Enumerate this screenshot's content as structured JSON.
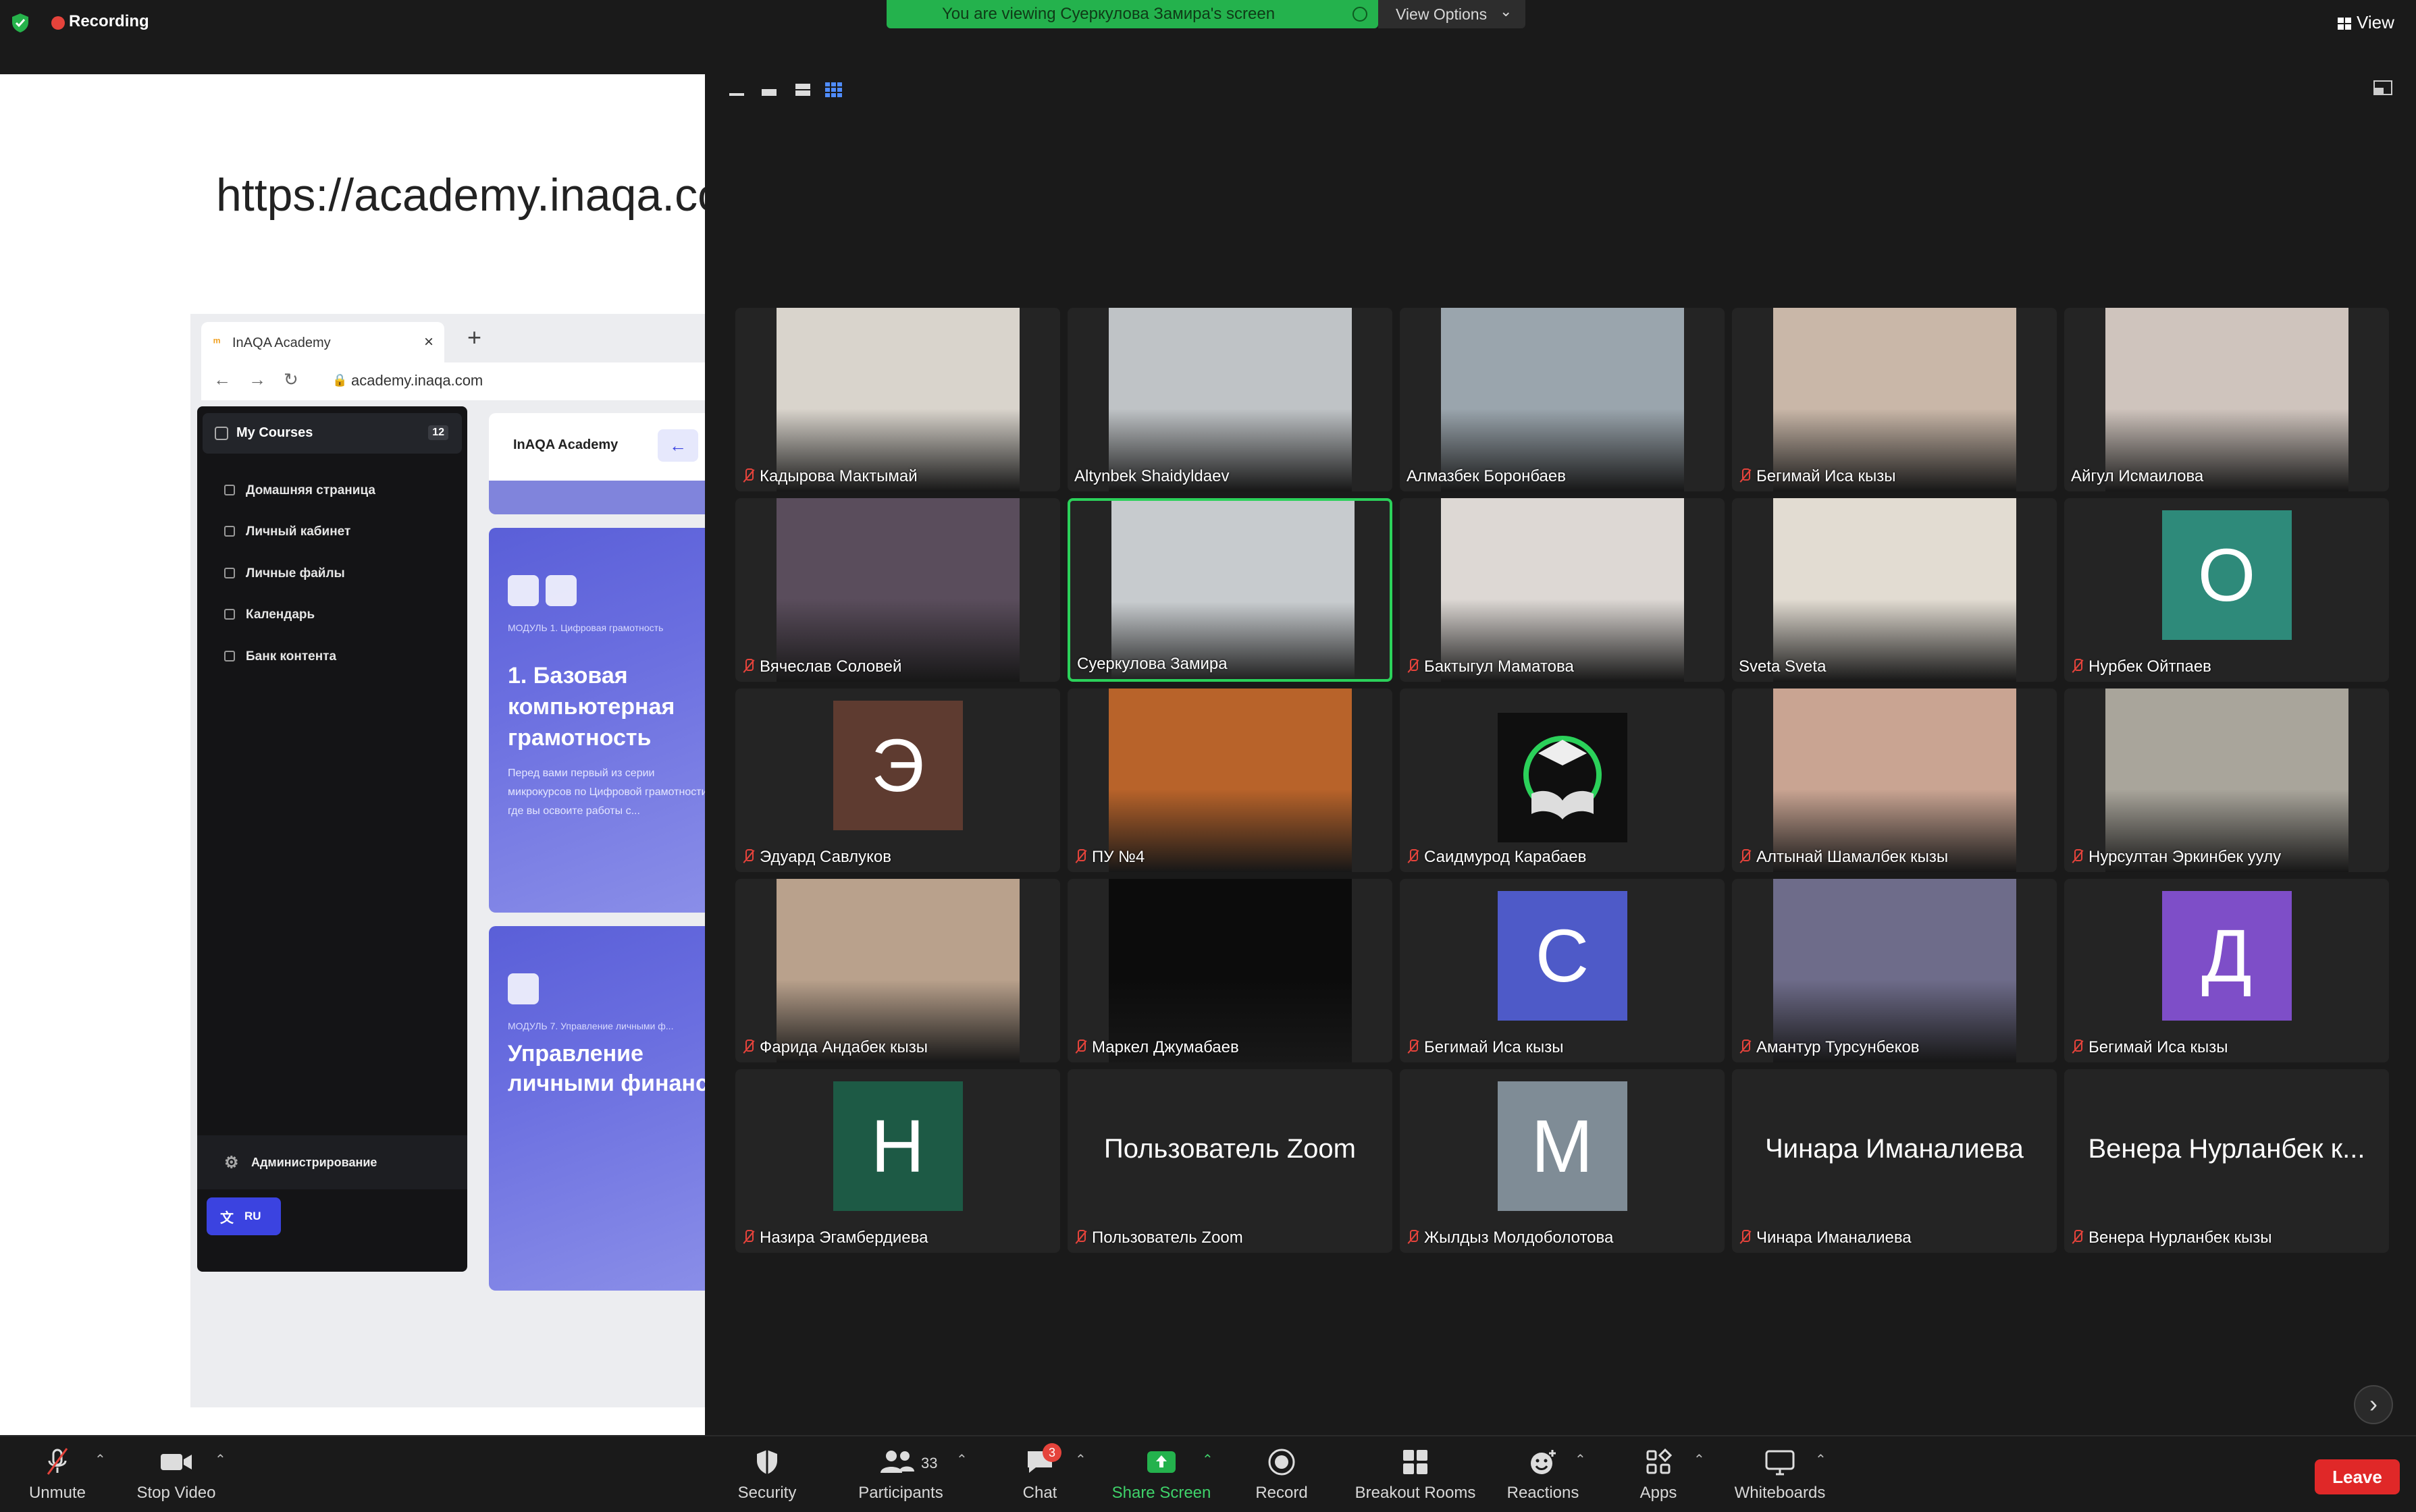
{
  "topbar": {
    "recording_label": "Recording",
    "viewing_banner": "You are viewing Суеркулова Замира's screen",
    "view_options_label": "View Options",
    "view_label": "View"
  },
  "shared_screen": {
    "url_text": "https://academy.inaqa.com",
    "browser_tab_title": "InAQA Academy",
    "browser_address": "academy.inaqa.com",
    "sidebar": {
      "my_courses": "My Courses",
      "my_courses_count": "12",
      "items": [
        "Домашняя страница",
        "Личный кабинет",
        "Личные файлы",
        "Календарь",
        "Банк контента"
      ],
      "admin": "Администрирование",
      "lang": "RU"
    },
    "logo_text": "InAQA Academy",
    "course1": {
      "module": "МОДУЛЬ 1. Цифровая грамотность",
      "title_lines": [
        "1. Базовая",
        "компьютерная",
        "грамотность"
      ],
      "desc": "Перед вами первый из серии микрокурсов по Цифровой грамотности, где вы освоите работы с..."
    },
    "course2": {
      "module": "МОДУЛЬ 7. Управление личными ф...",
      "title_lines": [
        "Управление",
        "личными финанс"
      ]
    }
  },
  "participants": [
    {
      "name": "Кадырова Мактымай",
      "muted": true,
      "kind": "video",
      "color": "#d9d4cc"
    },
    {
      "name": "Altynbek Shaidyldaev",
      "muted": false,
      "kind": "video",
      "color": "#bfc3c6"
    },
    {
      "name": "Алмазбек Боронбаев",
      "muted": false,
      "kind": "video",
      "color": "#9aa5ad"
    },
    {
      "name": "Бегимай Иса кызы",
      "muted": true,
      "kind": "video",
      "color": "#c9b7a8"
    },
    {
      "name": "Айгул Исмаилова",
      "muted": false,
      "kind": "video",
      "color": "#cfc4bd"
    },
    {
      "name": "Вячеслав Соловей",
      "muted": true,
      "kind": "video",
      "color": "#5a4d5c"
    },
    {
      "name": "Суеркулова Замира",
      "muted": false,
      "kind": "video",
      "color": "#c7cbce",
      "active": true
    },
    {
      "name": "Бактыгул Маматова",
      "muted": true,
      "kind": "video",
      "color": "#ddd8d4"
    },
    {
      "name": "Sveta Sveta",
      "muted": false,
      "kind": "video",
      "color": "#e2dcd2"
    },
    {
      "name": "Нурбек Ойтпаев",
      "muted": true,
      "kind": "avatar",
      "letter": "О",
      "color": "#2e8a7a"
    },
    {
      "name": "Эдуард Савлуков",
      "muted": true,
      "kind": "avatar",
      "letter": "Э",
      "color": "#5e3b30"
    },
    {
      "name": "ПУ №4",
      "muted": true,
      "kind": "video",
      "color": "#b8632a"
    },
    {
      "name": "Саидмурод Карабаев",
      "muted": true,
      "kind": "logo",
      "color": "#0f0f0f"
    },
    {
      "name": "Алтынай Шамалбек кызы",
      "muted": true,
      "kind": "video",
      "color": "#c9a492"
    },
    {
      "name": "Нурсултан Эркинбек уулу",
      "muted": true,
      "kind": "video",
      "color": "#a9a59b"
    },
    {
      "name": "Фарида Андабек кызы",
      "muted": true,
      "kind": "video",
      "color": "#b9a18c"
    },
    {
      "name": "Маркел Джумабаев",
      "muted": true,
      "kind": "video",
      "color": "#0c0c0c"
    },
    {
      "name": "Бегимай Иса кызы",
      "muted": true,
      "kind": "avatar",
      "letter": "С",
      "color": "#4e5ac8"
    },
    {
      "name": "Амантур Турсунбеков",
      "muted": true,
      "kind": "video",
      "color": "#6e6c8a"
    },
    {
      "name": "Бегимай Иса кызы",
      "muted": true,
      "kind": "avatar",
      "letter": "Д",
      "color": "#7e4ec8"
    },
    {
      "name": "Назира Эгамбердиева",
      "muted": true,
      "kind": "avatar",
      "letter": "Н",
      "color": "#1d5a45"
    },
    {
      "name": "Пользователь Zoom",
      "muted": true,
      "kind": "text",
      "big": "Пользователь Zoom"
    },
    {
      "name": "Жылдыз Молдоболотова",
      "muted": true,
      "kind": "avatar",
      "letter": "М",
      "color": "#7f8c96"
    },
    {
      "name": "Чинара Иманалиева",
      "muted": true,
      "kind": "text",
      "big": "Чинара Иманалиева"
    },
    {
      "name": "Венера Нурланбек кызы",
      "muted": true,
      "kind": "text",
      "big": "Венера Нурланбек к..."
    }
  ],
  "toolbar": {
    "unmute": "Unmute",
    "stop_video": "Stop Video",
    "security": "Security",
    "participants": "Participants",
    "participants_count": "33",
    "chat": "Chat",
    "chat_badge": "3",
    "share_screen": "Share Screen",
    "record": "Record",
    "breakout_rooms": "Breakout Rooms",
    "reactions": "Reactions",
    "apps": "Apps",
    "whiteboards": "Whiteboards",
    "leave": "Leave"
  }
}
